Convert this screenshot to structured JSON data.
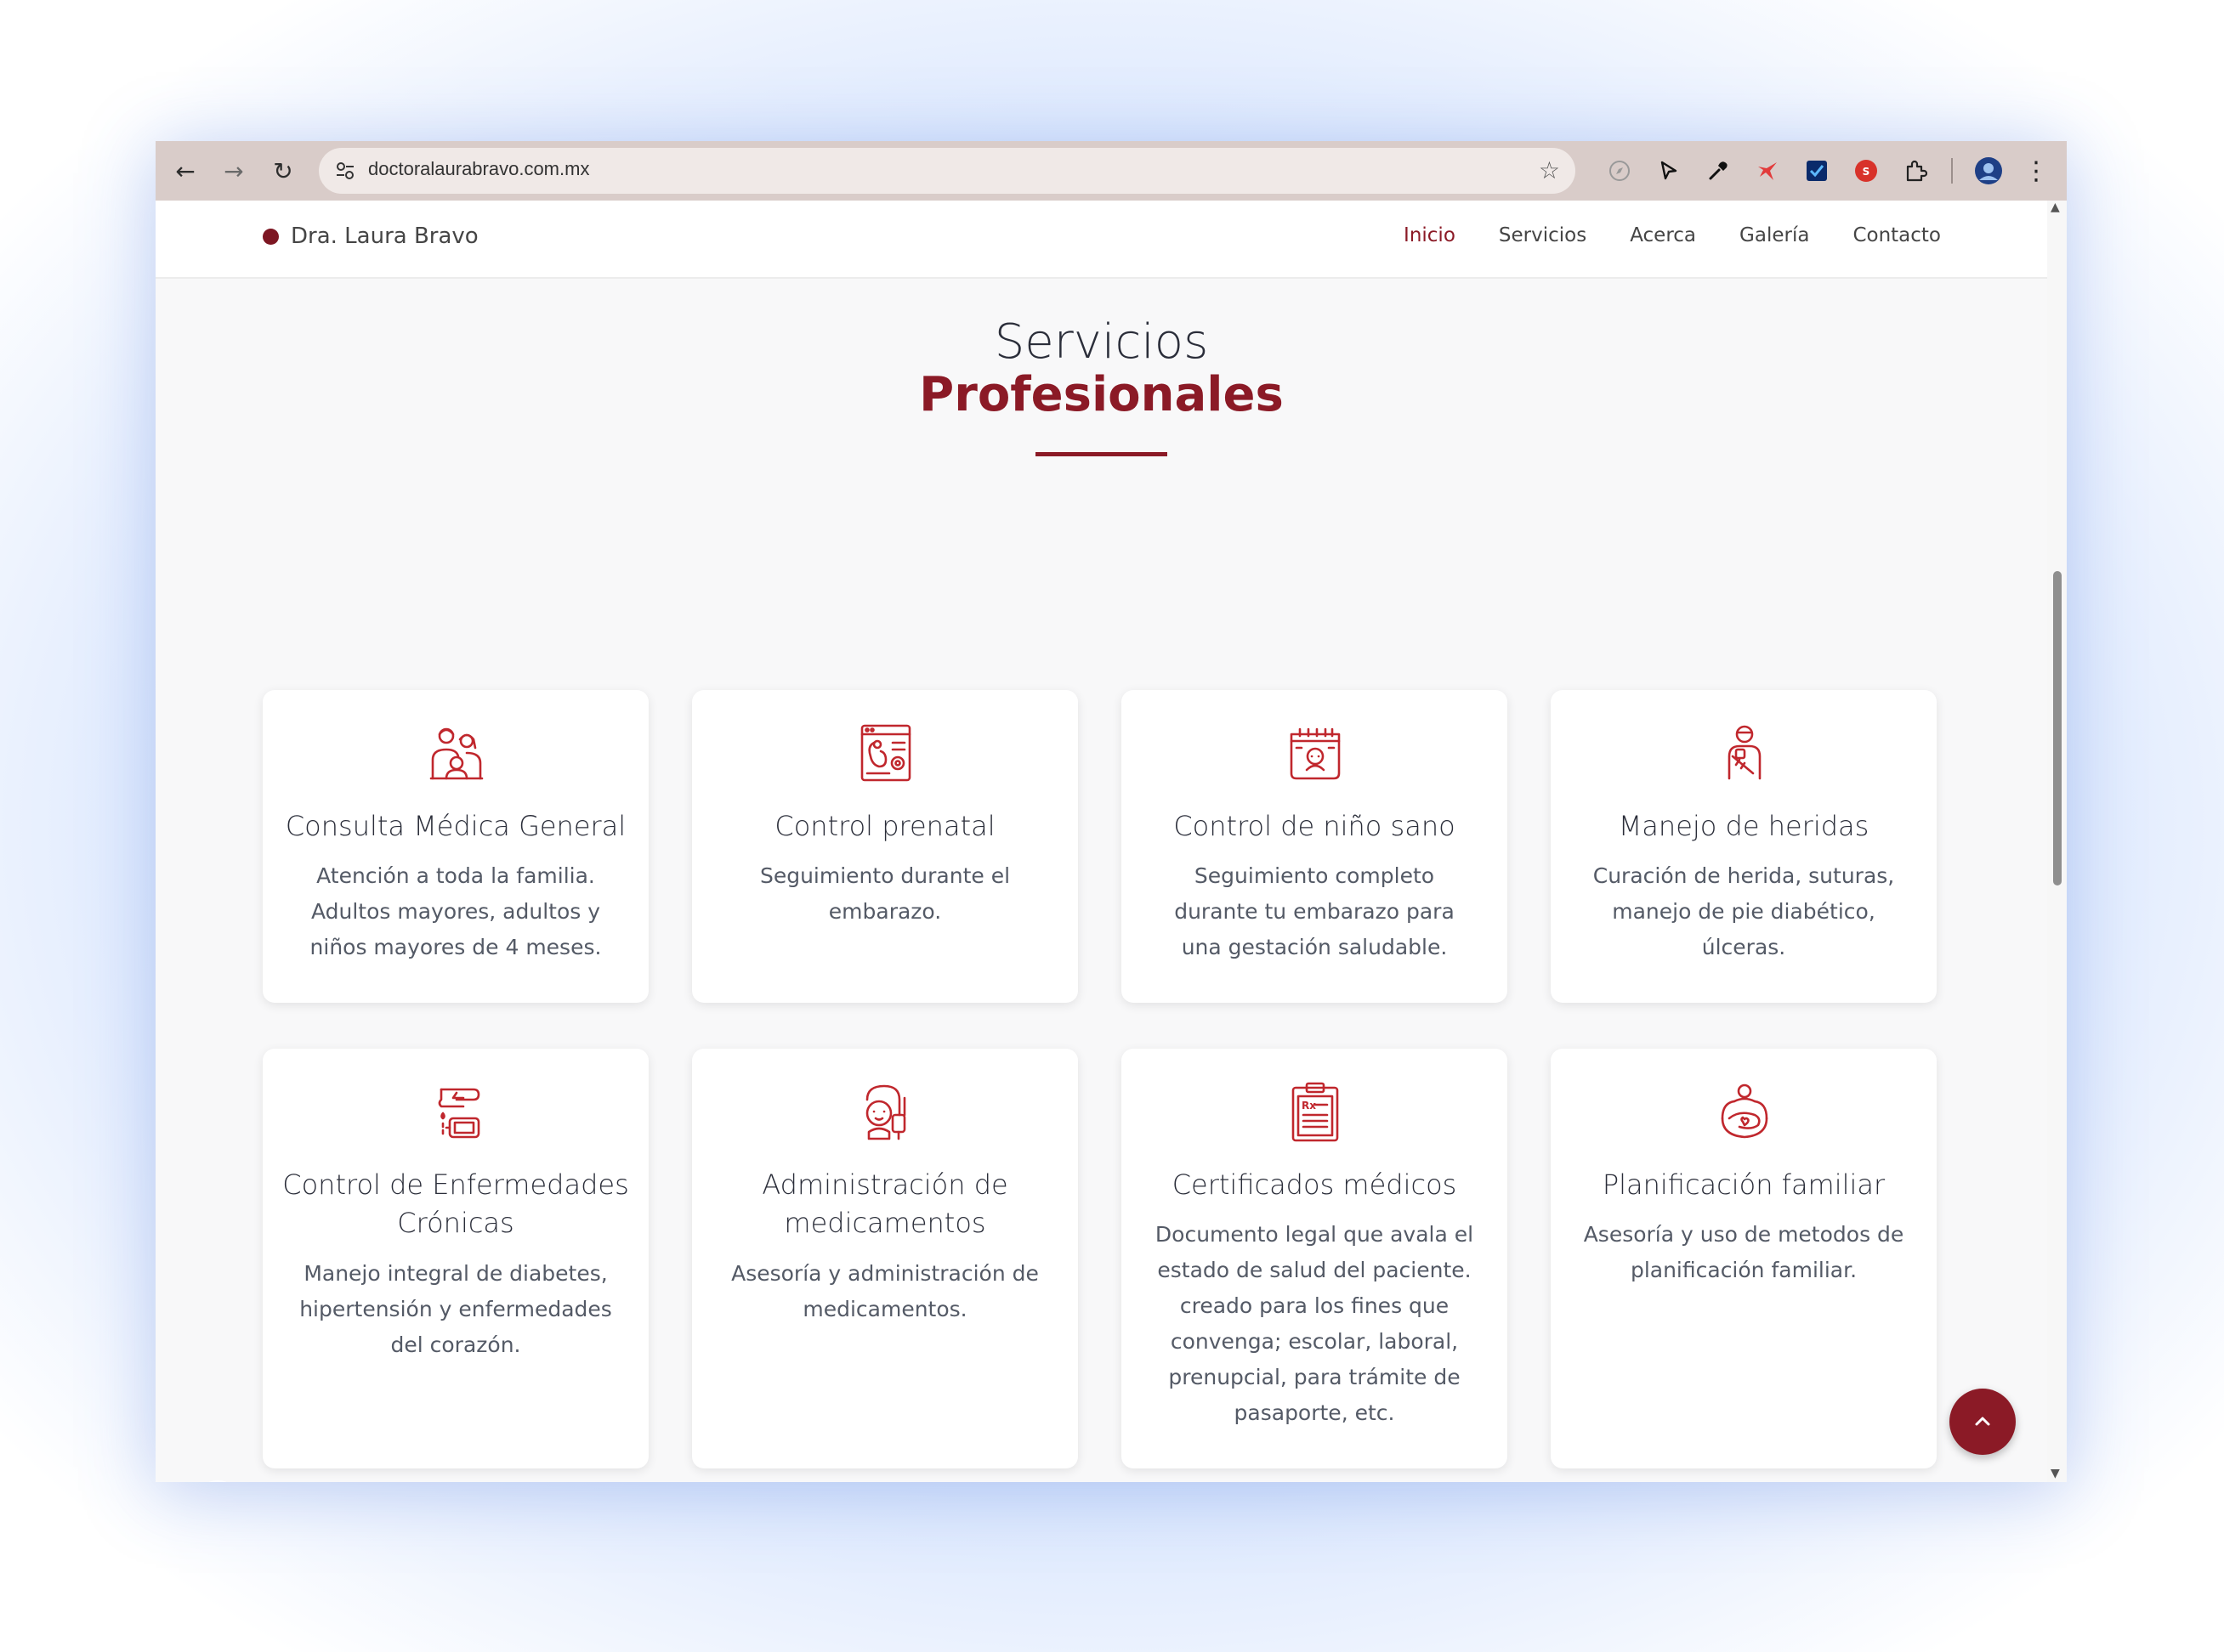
{
  "browser": {
    "url": "doctoralaurabravo.com.mx",
    "back_glyph": "←",
    "forward_glyph": "→",
    "reload_glyph": "↻",
    "star_glyph": "☆",
    "menu_glyph": "⋮"
  },
  "site": {
    "brand": "Dra. Laura Bravo",
    "nav": [
      {
        "label": "Inicio",
        "active": true
      },
      {
        "label": "Servicios",
        "active": false
      },
      {
        "label": "Acerca",
        "active": false
      },
      {
        "label": "Galería",
        "active": false
      },
      {
        "label": "Contacto",
        "active": false
      }
    ],
    "accent_color": "#8b1a26"
  },
  "section": {
    "title_line1": "Servicios",
    "title_line2": "Profesionales"
  },
  "services": [
    {
      "icon": "family-icon",
      "title": "Consulta Médica General",
      "description": "Atención a toda la familia. Adultos mayores, adultos y niños mayores de 4 meses."
    },
    {
      "icon": "prenatal-monitor-icon",
      "title": "Control prenatal",
      "description": "Seguimiento durante el embarazo."
    },
    {
      "icon": "baby-calendar-icon",
      "title": "Control de niño sano",
      "description": "Seguimiento completo durante tu embarazo para una gestación saludable."
    },
    {
      "icon": "bandaged-patient-icon",
      "title": "Manejo de heridas",
      "description": "Curación de herida, suturas, manejo de pie diabético, úlceras."
    },
    {
      "icon": "glucometer-icon",
      "title": "Control de Enfermedades Crónicas",
      "description": "Manejo integral de diabetes, hipertensión y enfermedades del corazón."
    },
    {
      "icon": "iv-drip-patient-icon",
      "title": "Administración de medicamentos",
      "description": "Asesoría y administración de medicamentos."
    },
    {
      "icon": "prescription-clipboard-icon",
      "title": "Certificados médicos",
      "description": "Documento legal que avala el estado de salud del paciente. creado para los fines que convenga; escolar, laboral, prenupcial, para trámite de pasaporte, etc."
    },
    {
      "icon": "family-planning-icon",
      "title": "Planificación familiar",
      "description": "Asesoría y uso de metodos de planificación familiar."
    }
  ]
}
